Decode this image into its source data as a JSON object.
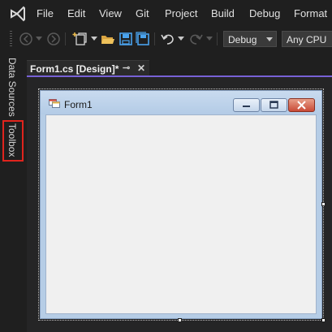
{
  "menu": {
    "items": [
      {
        "id": "file",
        "label": "File"
      },
      {
        "id": "edit",
        "label": "Edit"
      },
      {
        "id": "view",
        "label": "View"
      },
      {
        "id": "git",
        "label": "Git"
      },
      {
        "id": "project",
        "label": "Project"
      },
      {
        "id": "build",
        "label": "Build"
      },
      {
        "id": "debug",
        "label": "Debug"
      },
      {
        "id": "format",
        "label": "Format"
      }
    ]
  },
  "toolbar": {
    "configuration": "Debug",
    "platform": "Any CPU"
  },
  "sidetabs": {
    "data_sources": "Data Sources",
    "toolbox": "Toolbox"
  },
  "document_tab": {
    "title": "Form1.cs [Design]*",
    "pin_glyph": "⊸",
    "close_glyph": "✕"
  },
  "form": {
    "title": "Form1"
  },
  "colors": {
    "accent": "#7761d6",
    "highlight": "#e0241d",
    "background": "#1f1f1f"
  }
}
